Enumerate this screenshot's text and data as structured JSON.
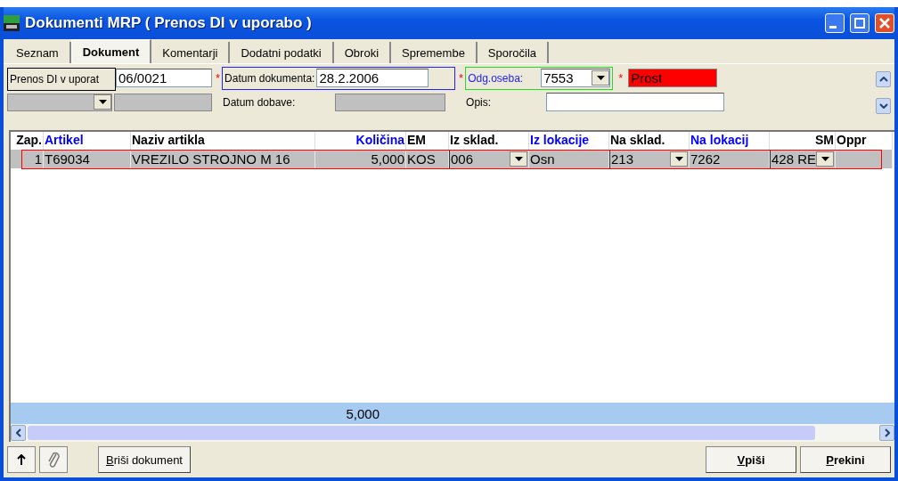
{
  "window": {
    "title": "Dokumenti MRP ( Prenos DI v uporabo )"
  },
  "tabs": [
    {
      "label": "Seznam",
      "selected": false
    },
    {
      "label": "Dokument",
      "selected": true
    },
    {
      "label": "Komentarji",
      "selected": false
    },
    {
      "label": "Dodatni podatki",
      "selected": false
    },
    {
      "label": "Obroki",
      "selected": false
    },
    {
      "label": "Spremembe",
      "selected": false
    },
    {
      "label": "Sporočila",
      "selected": false
    }
  ],
  "form": {
    "document_label": "Prenos DI v uporat",
    "document_value": "06/0021",
    "date_label": "Datum dokumenta:",
    "date_value": "28.2.2006",
    "delivery_label": "Datum dobave:",
    "person_label": "Odg.oseba:",
    "person_value": "7553",
    "status_value": "Prost",
    "description_label": "Opis:",
    "required_mark": "*"
  },
  "table": {
    "columns": [
      {
        "label": "Zap.",
        "color": "#000000",
        "kind": "number"
      },
      {
        "label": "Artikel",
        "color": "#0000ff",
        "kind": "text"
      },
      {
        "label": "Naziv artikla",
        "color": "#000000",
        "kind": "text"
      },
      {
        "label": "Količina",
        "color": "#0000ff",
        "kind": "number"
      },
      {
        "label": "EM",
        "color": "#000000",
        "kind": "text"
      },
      {
        "label": "Iz sklad.",
        "color": "#000000",
        "kind": "text"
      },
      {
        "label": "Iz lokacije",
        "color": "#0000ff",
        "kind": "text"
      },
      {
        "label": "Na sklad.",
        "color": "#000000",
        "kind": "text"
      },
      {
        "label": "Na lokacij",
        "color": "#0000ff",
        "kind": "text"
      },
      {
        "label": "SM",
        "color": "#000000",
        "kind": "number"
      },
      {
        "label": "Oppr",
        "color": "#000000",
        "kind": "text"
      }
    ],
    "rows": [
      {
        "cells": [
          {
            "text": "1",
            "kind": "number"
          },
          {
            "text": "T69034",
            "kind": "text"
          },
          {
            "text": "VREZILO STROJNO M 16",
            "kind": "text"
          },
          {
            "text": "5,000",
            "kind": "number"
          },
          {
            "text": "KOS",
            "kind": "text"
          },
          {
            "text": "006",
            "kind": "combo"
          },
          {
            "text": "Osn",
            "kind": "text"
          },
          {
            "text": "213",
            "kind": "combo"
          },
          {
            "text": "7262",
            "kind": "text"
          },
          {
            "text": "428 RE",
            "kind": "combo"
          },
          {
            "kind": "blank"
          }
        ]
      }
    ],
    "total": "5,000"
  },
  "buttons": [
    {
      "label": "Briši dokument",
      "accel_first": true
    },
    {
      "label": "Vpiši",
      "accel_first": true
    },
    {
      "label": "Prekini",
      "accel_first": true
    }
  ]
}
